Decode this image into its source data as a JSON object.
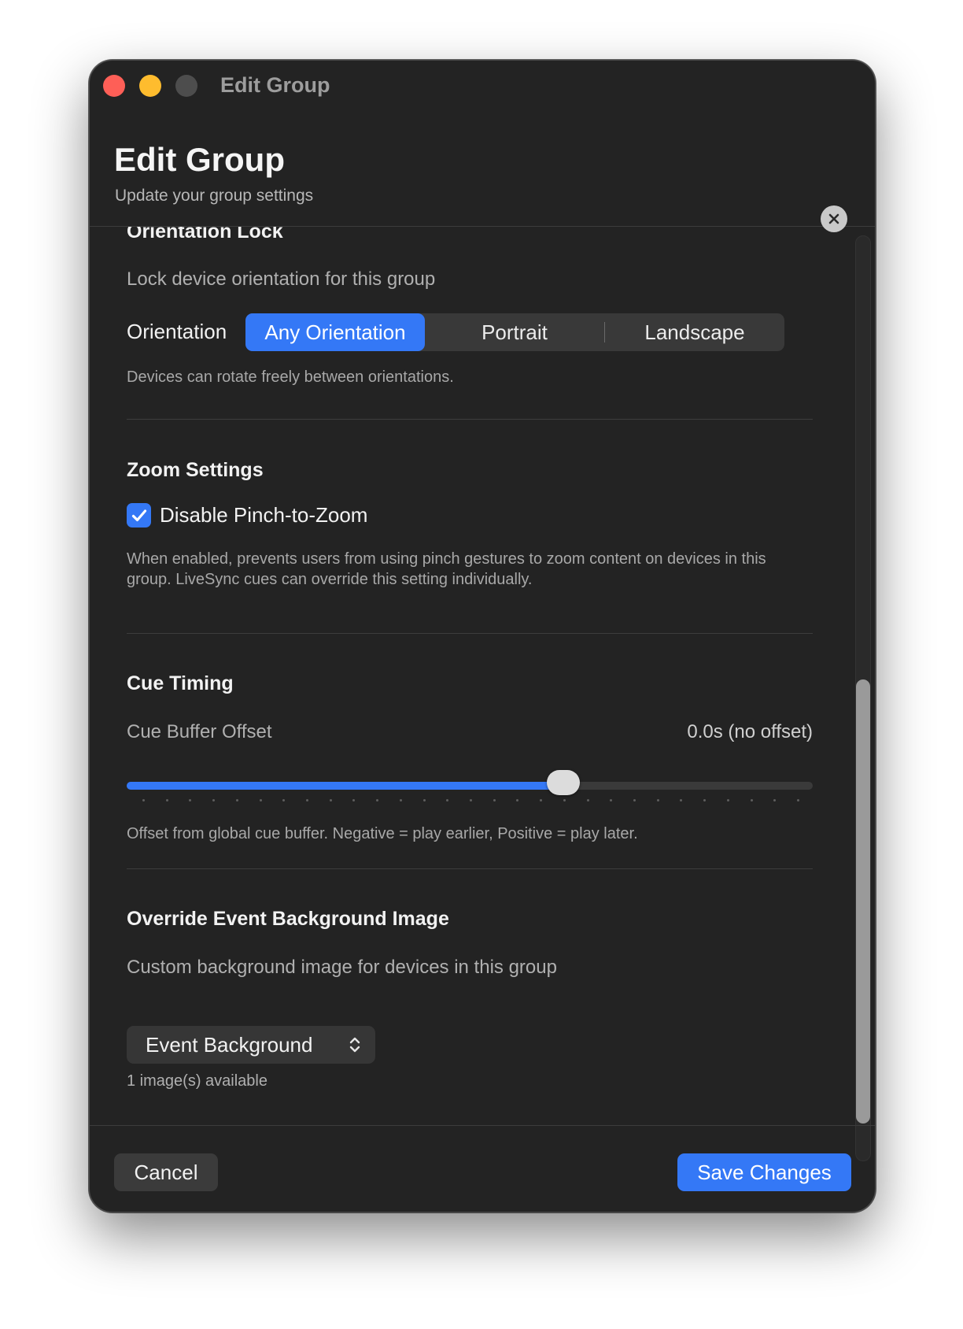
{
  "window": {
    "title": "Edit Group"
  },
  "header": {
    "title": "Edit Group",
    "subtitle": "Update your group settings"
  },
  "orientation": {
    "section_title": "Orientation Lock",
    "description": "Lock device orientation for this group",
    "label": "Orientation",
    "options": [
      "Any Orientation",
      "Portrait",
      "Landscape"
    ],
    "selected": "Any Orientation",
    "hint": "Devices can rotate freely between orientations."
  },
  "zoom": {
    "section_title": "Zoom Settings",
    "checkbox_label": "Disable Pinch-to-Zoom",
    "checked": true,
    "hint": "When enabled, prevents users from using pinch gestures to zoom content on devices in this group. LiveSync cues can override this setting individually."
  },
  "cue": {
    "section_title": "Cue Timing",
    "label": "Cue Buffer Offset",
    "value_text": "0.0s (no offset)",
    "slider_fraction": 0.637,
    "hint": "Offset from global cue buffer. Negative = play earlier, Positive = play later."
  },
  "background": {
    "section_title": "Override Event Background Image",
    "description": "Custom background image for devices in this group",
    "selected": "Event Background",
    "hint": "1 image(s) available"
  },
  "footer": {
    "cancel_label": "Cancel",
    "save_label": "Save Changes"
  },
  "colors": {
    "accent": "#3478f6",
    "window_bg": "#232323",
    "close": "#fe5f57",
    "minimize": "#febc2e"
  }
}
